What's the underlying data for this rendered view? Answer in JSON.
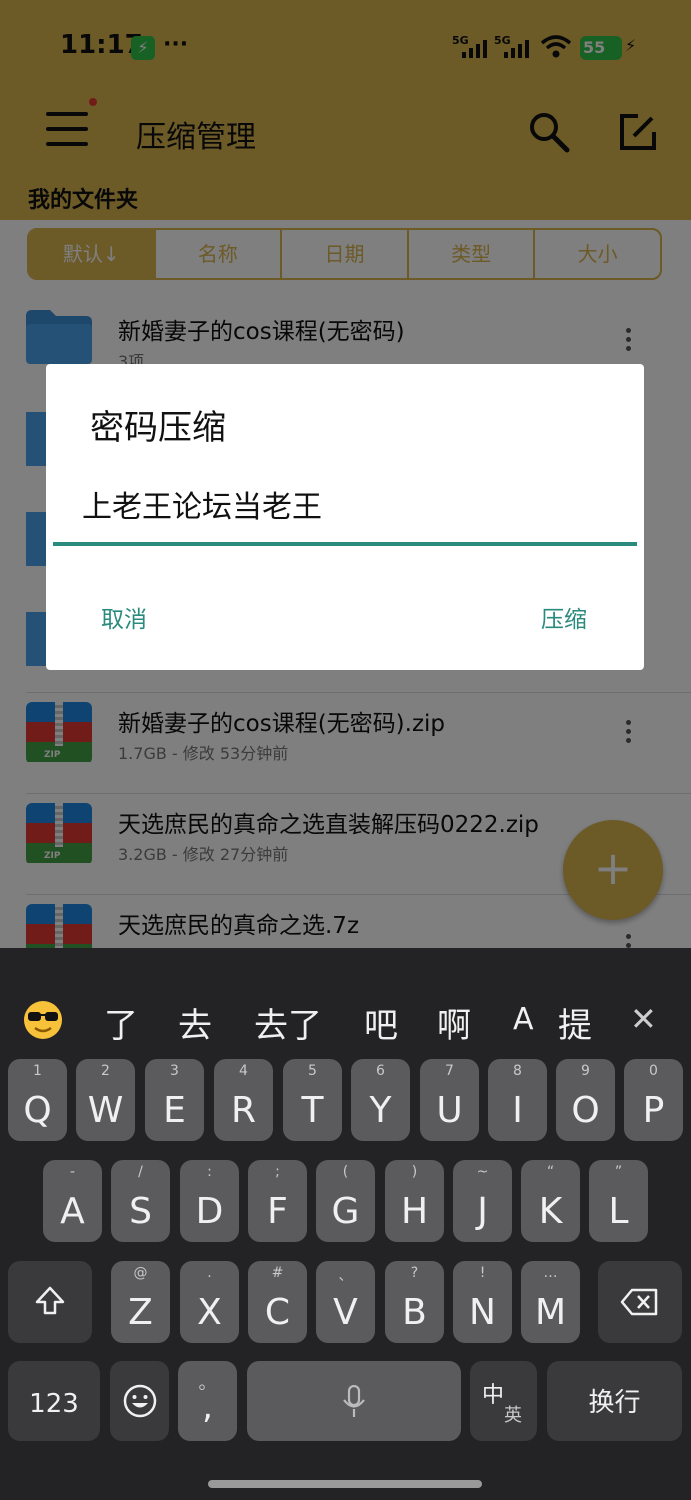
{
  "status": {
    "time": "11:17",
    "battery": "55",
    "signal1": "5G",
    "signal2": "5G"
  },
  "appbar": {
    "title": "压缩管理",
    "subtitle": "我的文件夹"
  },
  "sort": [
    "默认↓",
    "名称",
    "日期",
    "类型",
    "大小"
  ],
  "rows": [
    {
      "name": "新婚妻子的cos课程(无密码)",
      "meta": "3项",
      "type": "folder"
    },
    {
      "name": "新婚妻子的cos课程(无密码).zip",
      "meta": "1.7GB - 修改 53分钟前",
      "type": "zip"
    },
    {
      "name": "天选庶民的真命之选直装解压码0222.zip",
      "meta": "3.2GB - 修改 27分钟前",
      "type": "zip"
    },
    {
      "name": "天选庶民的真命之选.7z",
      "meta": "",
      "type": "zip"
    }
  ],
  "dialog": {
    "title": "密码压缩",
    "input_value": "上老王论坛当老王",
    "cancel": "取消",
    "confirm": "压缩"
  },
  "keyboard": {
    "suggestions": [
      "了",
      "去",
      "去了",
      "吧",
      "啊",
      "A",
      "提"
    ],
    "row1": [
      [
        "Q",
        "1"
      ],
      [
        "W",
        "2"
      ],
      [
        "E",
        "3"
      ],
      [
        "R",
        "4"
      ],
      [
        "T",
        "5"
      ],
      [
        "Y",
        "6"
      ],
      [
        "U",
        "7"
      ],
      [
        "I",
        "8"
      ],
      [
        "O",
        "9"
      ],
      [
        "P",
        "0"
      ]
    ],
    "row2": [
      [
        "A",
        "-"
      ],
      [
        "S",
        "/"
      ],
      [
        "D",
        ":"
      ],
      [
        "F",
        ";"
      ],
      [
        "G",
        "("
      ],
      [
        "H",
        ")"
      ],
      [
        "J",
        "~"
      ],
      [
        "K",
        "“"
      ],
      [
        "L",
        "”"
      ]
    ],
    "row3": [
      [
        "Z",
        "@"
      ],
      [
        "X",
        "."
      ],
      [
        "C",
        "#"
      ],
      [
        "V",
        "、"
      ],
      [
        "B",
        "?"
      ],
      [
        "N",
        "!"
      ],
      [
        "M",
        "…"
      ]
    ],
    "num_key": "123",
    "punct_key": ",",
    "punct_hint": "。",
    "lang_key_top": "中",
    "lang_key_bottom": "英",
    "enter_key": "换行"
  },
  "colors": {
    "accent": "#d8b54f",
    "teal": "#2a8a7d"
  }
}
